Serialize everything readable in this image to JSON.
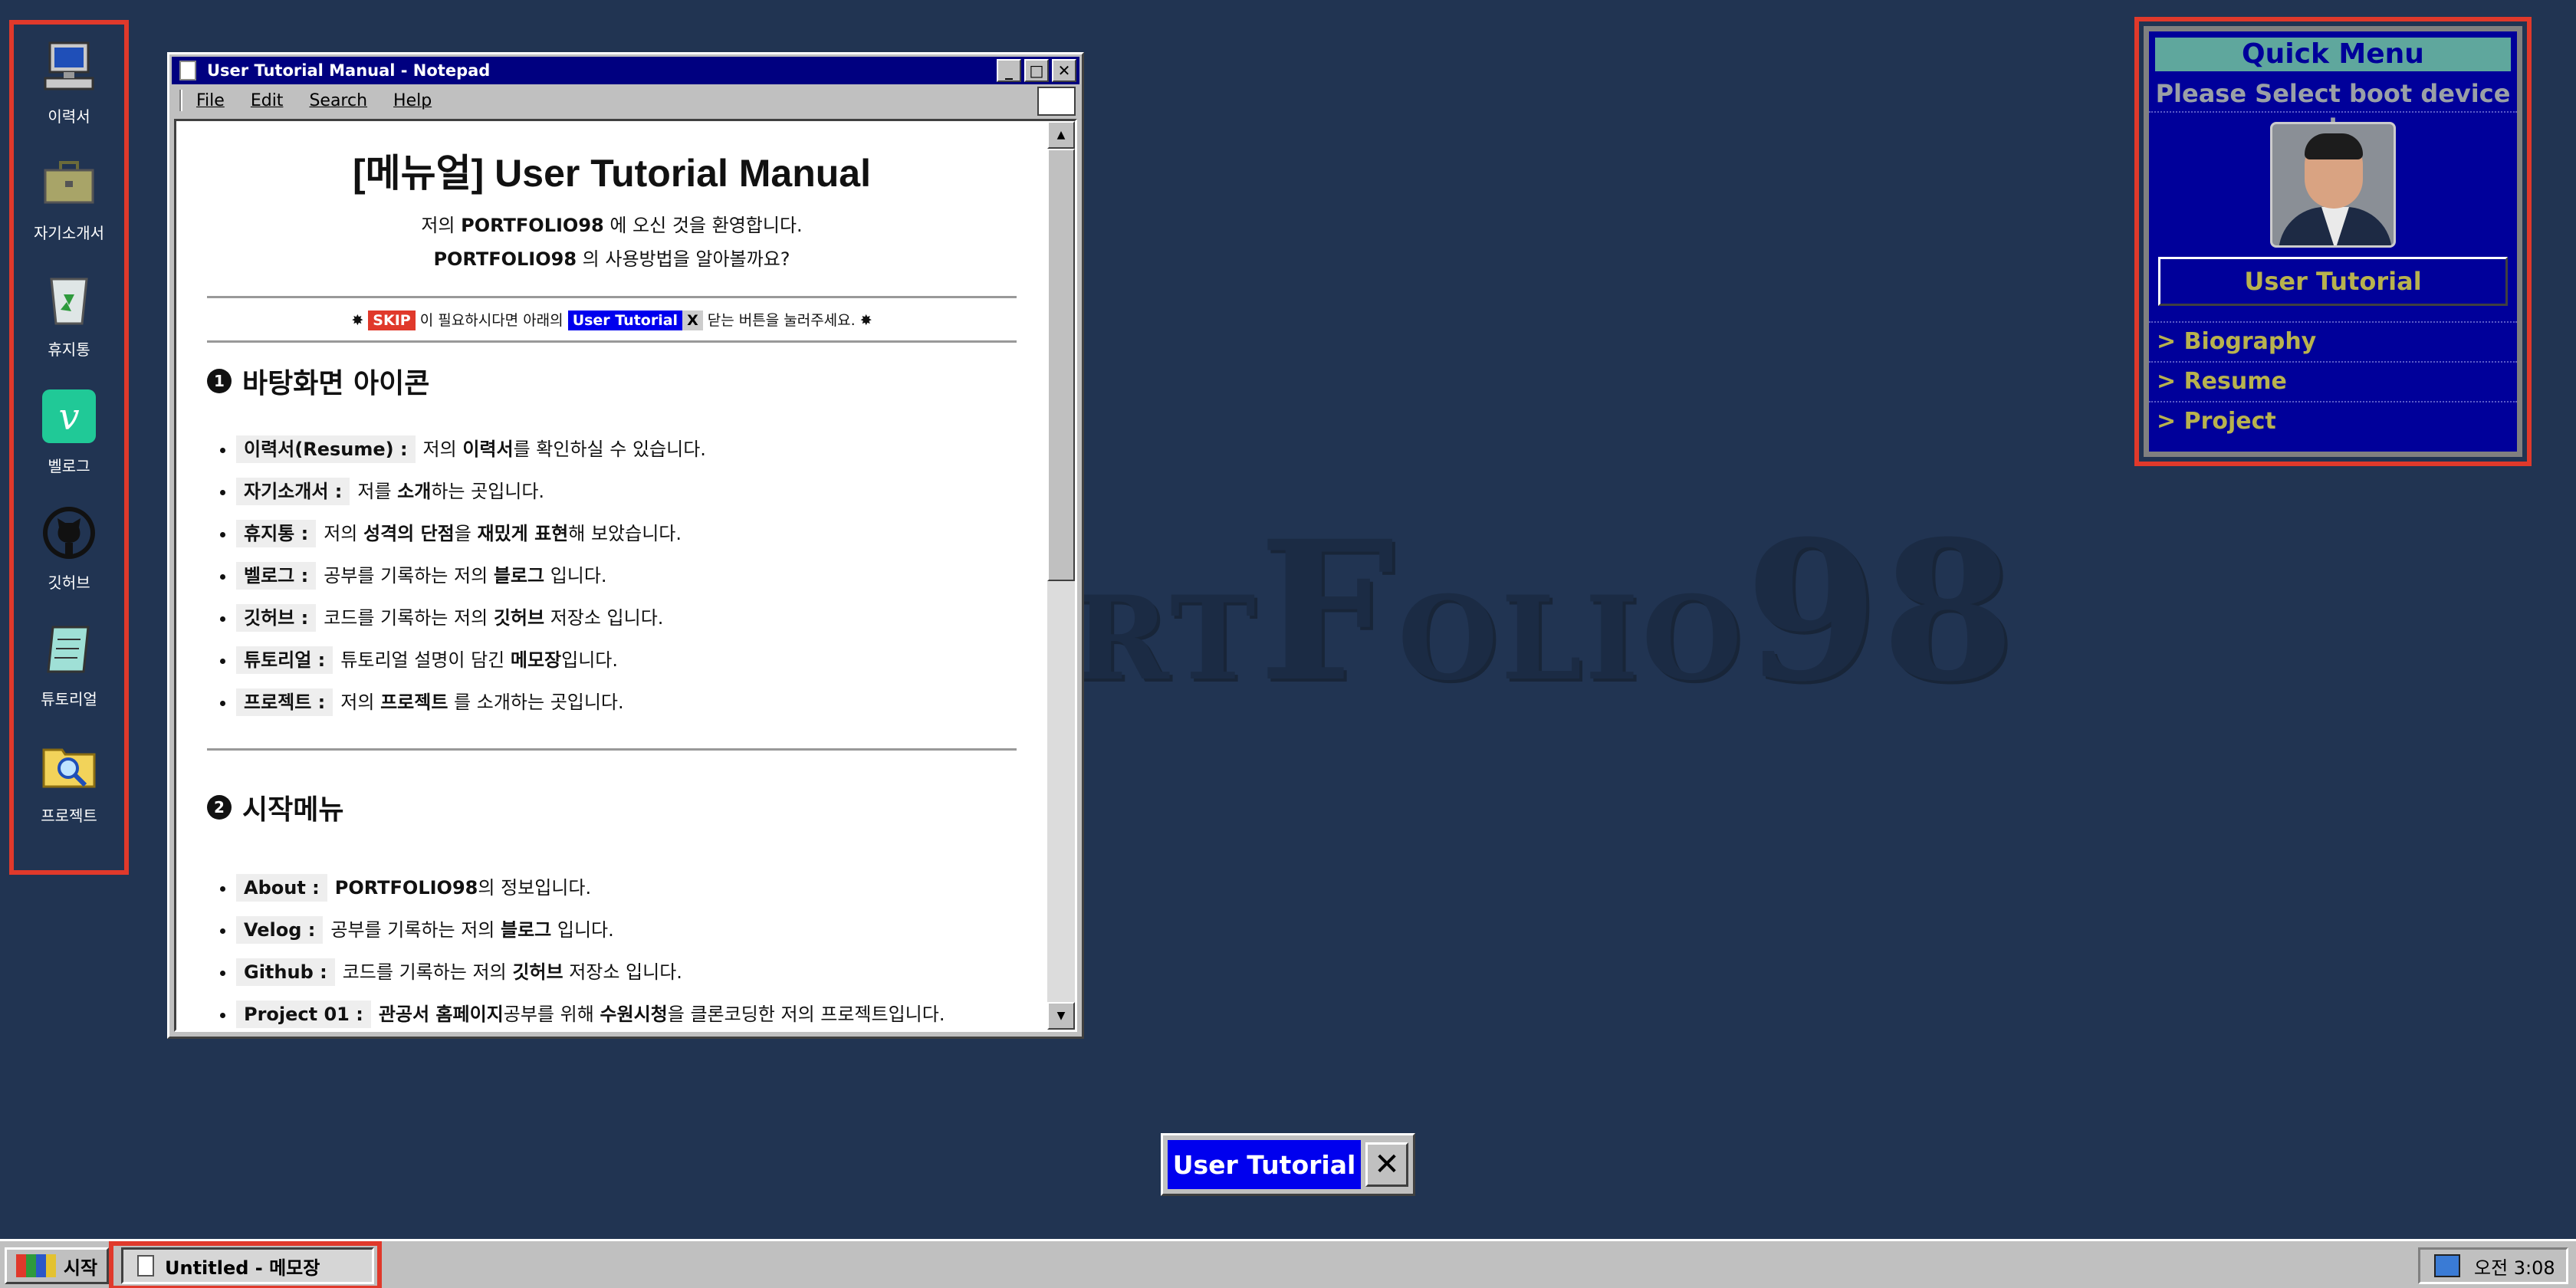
{
  "watermark": {
    "text_small": "RT",
    "text_mid": "FOLIO",
    "text_big": "98"
  },
  "desktop_icons": [
    {
      "label": "이력서",
      "icon": "computer-icon"
    },
    {
      "label": "자기소개서",
      "icon": "briefcase-icon"
    },
    {
      "label": "휴지통",
      "icon": "recycle-bin-icon"
    },
    {
      "label": "벨로그",
      "icon": "velog-icon"
    },
    {
      "label": "깃허브",
      "icon": "github-icon"
    },
    {
      "label": "튜토리얼",
      "icon": "notepad-icon"
    },
    {
      "label": "프로젝트",
      "icon": "folder-search-icon"
    }
  ],
  "window": {
    "title": "User Tutorial Manual - Notepad",
    "menu": [
      "File",
      "Edit",
      "Search",
      "Help"
    ],
    "doc": {
      "heading": "[메뉴얼] User Tutorial Manual",
      "intro_pre": "저의 ",
      "intro_bold": "PORTFOLIO98",
      "intro_post": " 에 오신 것을 환영합니다.",
      "intro2_bold": "PORTFOLIO98",
      "intro2_post": " 의 사용방법을 알아볼까요?",
      "skip_label": "SKIP",
      "skip_mid": "이 필요하시다면 아래의",
      "ut_label": "User Tutorial",
      "x_label": "X",
      "skip_tail": "닫는 버튼을 눌러주세요.",
      "star": "✸",
      "sec1_num": "1",
      "sec1_title": "바탕화면 아이콘",
      "sec1_items": [
        {
          "key": "이력서(Resume) :",
          "pre": "저의 ",
          "bold": "이력서",
          "post": "를 확인하실 수 있습니다."
        },
        {
          "key": "자기소개서 :",
          "pre": "저를 ",
          "bold": "소개",
          "post": "하는 곳입니다."
        },
        {
          "key": "휴지통 :",
          "pre": "저의 ",
          "bold": "성격의 단점",
          "post": "을 ",
          "bold2": "재밌게 표현",
          "post2": "해 보았습니다."
        },
        {
          "key": "벨로그 :",
          "pre": "공부를 기록하는 저의 ",
          "bold": "블로그",
          "post": " 입니다."
        },
        {
          "key": "깃허브 :",
          "pre": "코드를 기록하는 저의 ",
          "bold": "깃허브",
          "post": " 저장소 입니다."
        },
        {
          "key": "튜토리얼 :",
          "pre": "튜토리얼 설명이 담긴 ",
          "bold": "메모장",
          "post": "입니다."
        },
        {
          "key": "프로젝트 :",
          "pre": "저의 ",
          "bold": "프로젝트",
          "post": " 를 소개하는 곳입니다."
        }
      ],
      "sec2_num": "2",
      "sec2_title": "시작메뉴",
      "sec2_items": [
        {
          "key": "About :",
          "pre": "",
          "bold": "PORTFOLIO98",
          "post": "의 정보입니다."
        },
        {
          "key": "Velog :",
          "pre": "공부를 기록하는 저의 ",
          "bold": "블로그",
          "post": " 입니다."
        },
        {
          "key": "Github :",
          "pre": "코드를 기록하는 저의 ",
          "bold": "깃허브",
          "post": " 저장소 입니다."
        },
        {
          "key": "Project 01 :",
          "pre": "",
          "bold": "관공서 홈페이지",
          "post": "공부를 위해 ",
          "bold2": "수원시청",
          "post2": "을 클론코딩한 저의 프로젝트입니다."
        }
      ]
    }
  },
  "quick_menu": {
    "title": "Quick Menu",
    "boot": "Please Select boot device :",
    "button": "User Tutorial",
    "links": [
      "> Biography",
      "> Resume",
      "> Project"
    ]
  },
  "floating": {
    "label": "User Tutorial",
    "close": "✕"
  },
  "taskbar": {
    "start": "시작",
    "task": "Untitled - 메모장",
    "clock": "오전 3:08"
  }
}
